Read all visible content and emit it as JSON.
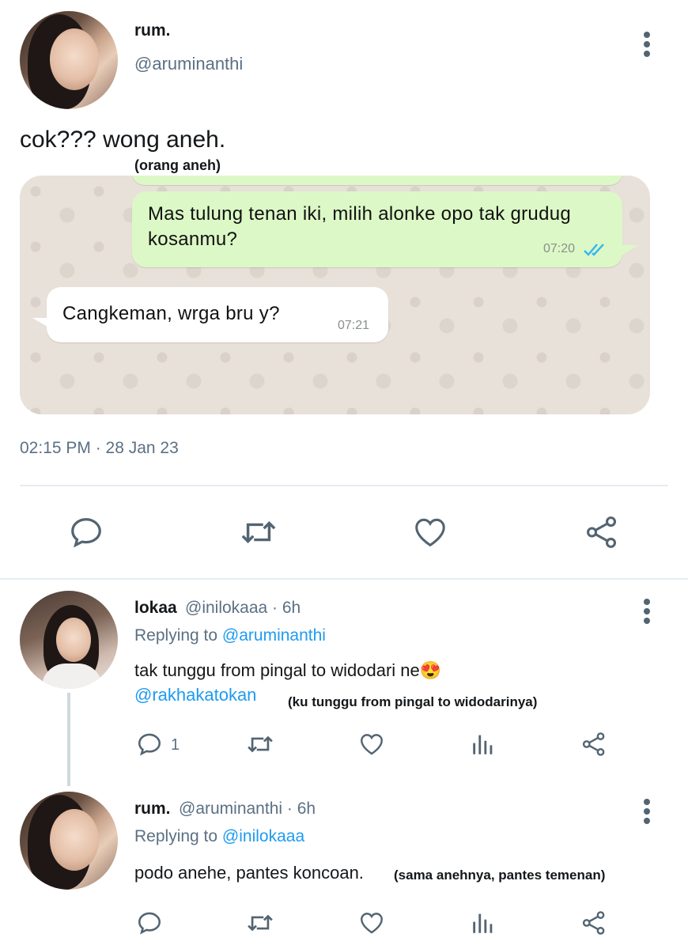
{
  "main_tweet": {
    "display_name": "rum.",
    "handle": "@aruminanthi",
    "text": "cok??? wong aneh.",
    "annotation": "(orang aneh)",
    "timestamp": "02:15 PM · 28 Jan 23"
  },
  "chat": {
    "outgoing_text": "Mas tulung tenan iki, milih alonke opo tak grudug kosanmu?",
    "outgoing_time": "07:20",
    "incoming_text": "Cangkeman, wrga bru y?",
    "incoming_time": "07:21"
  },
  "reply1": {
    "display_name": "lokaa",
    "handle_time": "@inilokaaa · 6h",
    "replying_label": "Replying to",
    "replying_to": "@aruminanthi",
    "text": "tak tunggu from pingal to widodari ne😍",
    "mention": "@rakhakatokan",
    "annotation": "(ku tunggu from pingal to widodarinya)",
    "reply_count": "1"
  },
  "reply2": {
    "display_name": "rum.",
    "handle_time": "@aruminanthi · 6h",
    "replying_label": "Replying to",
    "replying_to": "@inilokaaa",
    "text": "podo anehe, pantes koncoan.",
    "annotation": "(sama anehnya, pantes temenan)"
  },
  "colors": {
    "link": "#1d9bf0",
    "icon": "#536471",
    "chat_outgoing": "#dcf8c6",
    "read_ticks": "#34b7f1"
  }
}
